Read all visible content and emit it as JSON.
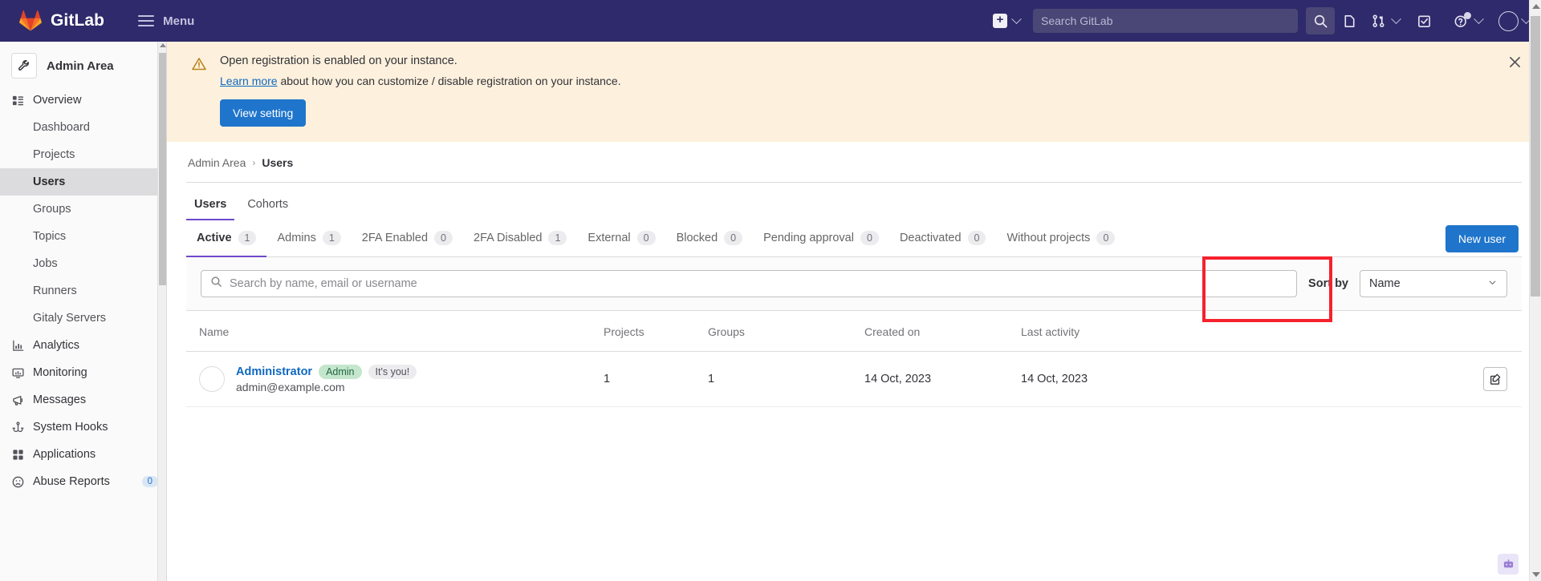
{
  "topnav": {
    "brand": "GitLab",
    "menu_label": "Menu",
    "search_placeholder": "Search GitLab",
    "icons": {
      "plus": "plus-square-icon",
      "search": "search-icon",
      "issues": "issues-icon",
      "merge_requests": "merge-request-icon",
      "todos": "todo-checkbox-icon",
      "help": "help-question-icon",
      "avatar": "user-avatar-icon"
    }
  },
  "sidebar": {
    "title": "Admin Area",
    "items": [
      {
        "label": "Overview",
        "icon": "overview-icon",
        "level": "top",
        "active": false
      },
      {
        "label": "Dashboard",
        "icon": "",
        "level": "sub",
        "active": false
      },
      {
        "label": "Projects",
        "icon": "",
        "level": "sub",
        "active": false
      },
      {
        "label": "Users",
        "icon": "",
        "level": "sub",
        "active": true
      },
      {
        "label": "Groups",
        "icon": "",
        "level": "sub",
        "active": false
      },
      {
        "label": "Topics",
        "icon": "",
        "level": "sub",
        "active": false
      },
      {
        "label": "Jobs",
        "icon": "",
        "level": "sub",
        "active": false
      },
      {
        "label": "Runners",
        "icon": "",
        "level": "sub",
        "active": false
      },
      {
        "label": "Gitaly Servers",
        "icon": "",
        "level": "sub",
        "active": false
      },
      {
        "label": "Analytics",
        "icon": "analytics-icon",
        "level": "top",
        "active": false
      },
      {
        "label": "Monitoring",
        "icon": "monitoring-icon",
        "level": "top",
        "active": false
      },
      {
        "label": "Messages",
        "icon": "messages-megaphone-icon",
        "level": "top",
        "active": false
      },
      {
        "label": "System Hooks",
        "icon": "system-hooks-icon",
        "level": "top",
        "active": false
      },
      {
        "label": "Applications",
        "icon": "applications-grid-icon",
        "level": "top",
        "active": false
      },
      {
        "label": "Abuse Reports",
        "icon": "abuse-reports-icon",
        "level": "top",
        "active": false,
        "badge": "0"
      }
    ]
  },
  "alert": {
    "icon": "warning-triangle-icon",
    "title": "Open registration is enabled on your instance.",
    "link_text": "Learn more",
    "body_text": " about how you can customize / disable registration on your instance.",
    "button_label": "View setting",
    "close_icon": "close-icon"
  },
  "breadcrumb": {
    "root": "Admin Area",
    "separator": "›",
    "current": "Users"
  },
  "page_tabs": [
    {
      "label": "Users",
      "active": true
    },
    {
      "label": "Cohorts",
      "active": false
    }
  ],
  "filter_tabs": [
    {
      "label": "Active",
      "count": "1",
      "active": true
    },
    {
      "label": "Admins",
      "count": "1",
      "active": false
    },
    {
      "label": "2FA Enabled",
      "count": "0",
      "active": false
    },
    {
      "label": "2FA Disabled",
      "count": "1",
      "active": false
    },
    {
      "label": "External",
      "count": "0",
      "active": false
    },
    {
      "label": "Blocked",
      "count": "0",
      "active": false
    },
    {
      "label": "Pending approval",
      "count": "0",
      "active": false
    },
    {
      "label": "Deactivated",
      "count": "0",
      "active": false
    },
    {
      "label": "Without projects",
      "count": "0",
      "active": false
    }
  ],
  "new_user_button": {
    "label": "New user",
    "highlighted": true,
    "highlight_color": "#f5222d"
  },
  "search": {
    "placeholder": "Search by name, email or username",
    "value": "",
    "icon": "search-icon",
    "sort_label": "Sort by",
    "sort_value": "Name",
    "sort_chevron": "chevron-down-icon"
  },
  "table": {
    "columns": [
      "Name",
      "Projects",
      "Groups",
      "Created on",
      "Last activity",
      ""
    ],
    "rows": [
      {
        "name": "Administrator",
        "badges": [
          {
            "text": "Admin",
            "style": "admin"
          },
          {
            "text": "It's you!",
            "style": "you"
          }
        ],
        "email": "admin@example.com",
        "projects": "1",
        "groups": "1",
        "created_on": "14 Oct, 2023",
        "last_activity": "14 Oct, 2023",
        "action_icon": "edit-pencil-icon"
      }
    ]
  },
  "colors": {
    "nav_purple": "#2f2a6b",
    "accent_blue": "#1f75cb",
    "link_blue": "#1068bf",
    "tab_underline": "#6e49cb",
    "alert_bg": "#fdf1dd",
    "admin_badge_bg": "#c3e6cd",
    "annotation_red": "#f5222d"
  }
}
